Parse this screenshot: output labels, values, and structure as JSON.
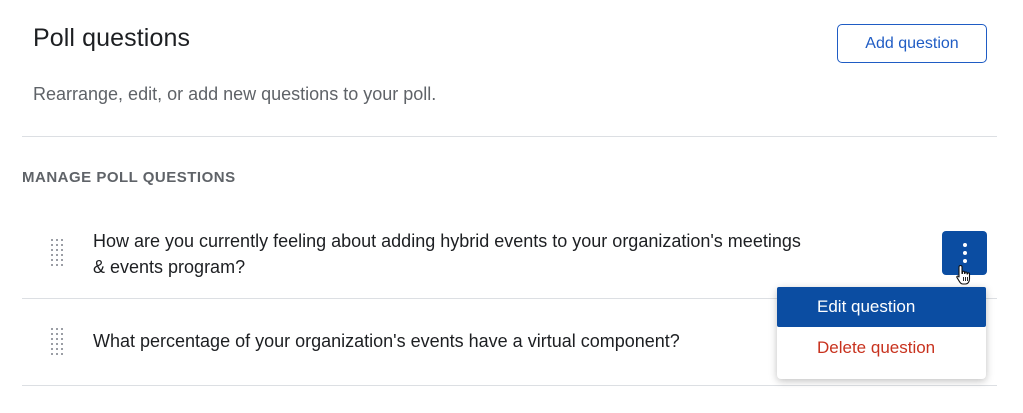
{
  "header": {
    "title": "Poll questions",
    "add_button_label": "Add question",
    "subtitle": "Rearrange, edit, or add new questions to your poll."
  },
  "section": {
    "label": "MANAGE POLL QUESTIONS"
  },
  "questions": [
    {
      "text_line1": "How are you currently feeling about adding hybrid events to your organization's meetings",
      "text_line2": "& events program?"
    },
    {
      "text_line1": "What percentage of your organization's events have a virtual component?"
    }
  ],
  "menu": {
    "edit_label": "Edit question",
    "delete_label": "Delete question"
  },
  "icons": {
    "drag": "drag-handle-icon",
    "more": "more-vertical-icon",
    "cursor": "hand-pointer-cursor"
  },
  "colors": {
    "primary": "#0b4da2",
    "button_border": "#1f5cc4",
    "danger": "#c8321e",
    "muted": "#5f6368"
  }
}
